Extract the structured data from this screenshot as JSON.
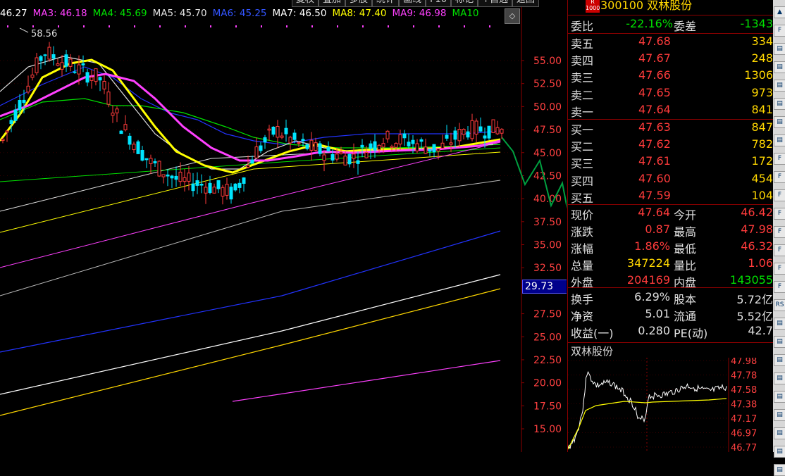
{
  "ma_legend": [
    {
      "label": "46.27",
      "color": "#ffffff"
    },
    {
      "label": "MA3: 46.18",
      "color": "#ff40ff"
    },
    {
      "label": "MA4: 45.69",
      "color": "#00e000"
    },
    {
      "label": "MA5: 45.70",
      "color": "#e0e0e0"
    },
    {
      "label": "MA6: 45.25",
      "color": "#3355ff"
    },
    {
      "label": "MA7: 46.50",
      "color": "#ffffff"
    },
    {
      "label": "MA8: 47.40",
      "color": "#ffff00"
    },
    {
      "label": "MA9: 46.98",
      "color": "#ff40ff"
    },
    {
      "label": "MA10",
      "color": "#00e000"
    }
  ],
  "toolbar_buttons": [
    "复权",
    "叠加",
    "多股",
    "统计",
    "画线",
    "F10",
    "标记",
    "+自选",
    "返回"
  ],
  "scroll_icon": "diamond-icon",
  "price_axis": [
    "55.00",
    "52.50",
    "50.00",
    "47.50",
    "45.00",
    "42.50",
    "40.00",
    "37.50",
    "35.00",
    "32.50",
    "27.50",
    "25.00",
    "22.50",
    "20.00",
    "17.50",
    "15.00"
  ],
  "hover_price": "29.73",
  "high_annotation": "58.56",
  "stock": {
    "code": "300100",
    "name": "双林股份",
    "badge": "R 1000"
  },
  "weibi": {
    "label": "委比",
    "pct": "-22.16%",
    "label2": "委差",
    "value": "-1343"
  },
  "sell": [
    {
      "label": "卖五",
      "price": "47.68",
      "vol": "334"
    },
    {
      "label": "卖四",
      "price": "47.67",
      "vol": "248"
    },
    {
      "label": "卖三",
      "price": "47.66",
      "vol": "1306"
    },
    {
      "label": "卖二",
      "price": "47.65",
      "vol": "973"
    },
    {
      "label": "卖一",
      "price": "47.64",
      "vol": "841"
    }
  ],
  "buy": [
    {
      "label": "买一",
      "price": "47.63",
      "vol": "847"
    },
    {
      "label": "买二",
      "price": "47.62",
      "vol": "782"
    },
    {
      "label": "买三",
      "price": "47.61",
      "vol": "172"
    },
    {
      "label": "买四",
      "price": "47.60",
      "vol": "454"
    },
    {
      "label": "买五",
      "price": "47.59",
      "vol": "104"
    }
  ],
  "quote": [
    {
      "l1": "现价",
      "v1": "47.64",
      "c1": "red",
      "l2": "今开",
      "v2": "46.42",
      "c2": "red"
    },
    {
      "l1": "涨跌",
      "v1": "0.87",
      "c1": "red",
      "l2": "最高",
      "v2": "47.98",
      "c2": "red"
    },
    {
      "l1": "涨幅",
      "v1": "1.86%",
      "c1": "red",
      "l2": "最低",
      "v2": "46.32",
      "c2": "red"
    },
    {
      "l1": "总量",
      "v1": "347224",
      "c1": "yel",
      "l2": "量比",
      "v2": "1.06",
      "c2": "red"
    },
    {
      "l1": "外盘",
      "v1": "204169",
      "c1": "red",
      "l2": "内盘",
      "v2": "143055",
      "c2": "grn"
    }
  ],
  "fund": [
    {
      "l1": "换手",
      "v1": "6.29%",
      "l2": "股本",
      "v2": "5.72亿"
    },
    {
      "l1": "净资",
      "v1": "5.01",
      "l2": "流通",
      "v2": "5.52亿"
    },
    {
      "l1": "收益(一)",
      "v1": "0.280",
      "l2": "PE(动)",
      "v2": "42.7"
    }
  ],
  "mini": {
    "title": "双林股份",
    "axis": [
      "47.98",
      "47.78",
      "47.58",
      "47.38",
      "47.17",
      "46.97",
      "46.77"
    ]
  },
  "colors": {
    "up": "#ff3b3b",
    "down": "#00e5ff",
    "grid": "#8b0000",
    "axis_text": "#ff4040"
  },
  "toolbar_icons": [
    "caret-up-icon",
    "f-icon",
    "chart-icon",
    "chart-icon",
    "chart-icon",
    "chart-icon",
    "chart-icon",
    "chart-icon",
    "f-icon",
    "f-icon",
    "f-icon",
    "f-icon",
    "f-icon",
    "f-icon",
    "f-icon",
    "f-icon",
    "rs-icon",
    "chart-icon",
    "chart-icon",
    "chart-icon",
    "chart-icon",
    "chart-icon",
    "chart-icon",
    "chart-icon",
    "chart-icon",
    "chart-icon"
  ]
}
